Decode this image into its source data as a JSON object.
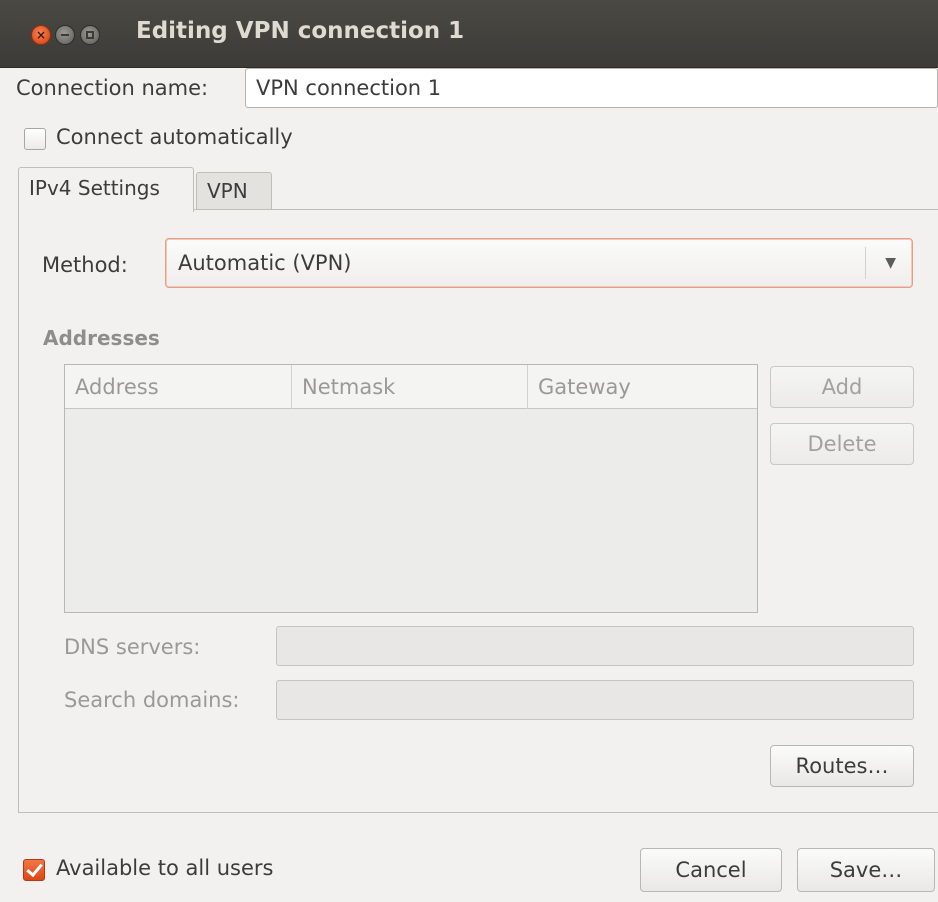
{
  "window": {
    "title": "Editing VPN connection 1"
  },
  "connection": {
    "name_label": "Connection name:",
    "name_value": "VPN connection 1",
    "auto_connect_label": "Connect automatically",
    "auto_connect_checked": false
  },
  "tabs": [
    {
      "label": "IPv4 Settings",
      "active": true
    },
    {
      "label": "VPN",
      "active": false
    }
  ],
  "ipv4": {
    "method_label": "Method:",
    "method_value": "Automatic (VPN)",
    "addresses_heading": "Addresses",
    "columns": [
      "Address",
      "Netmask",
      "Gateway"
    ],
    "rows": [],
    "add_label": "Add",
    "delete_label": "Delete",
    "dns_label": "DNS servers:",
    "dns_value": "",
    "search_label": "Search domains:",
    "search_value": "",
    "routes_label": "Routes…"
  },
  "footer": {
    "all_users_label": "Available to all users",
    "all_users_checked": true,
    "cancel_label": "Cancel",
    "save_label": "Save…"
  },
  "colors": {
    "accent": "#dd4814",
    "titlebar": "#3c3b37"
  }
}
